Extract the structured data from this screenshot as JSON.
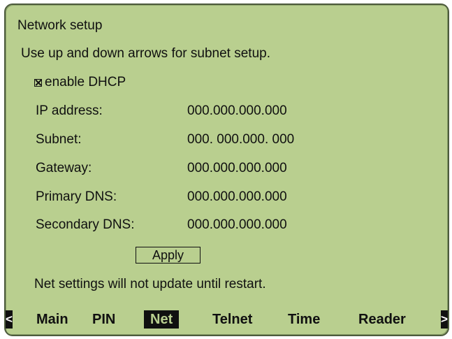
{
  "screen": {
    "title": "Network setup",
    "instructions": "Use up and down arrows for subnet setup."
  },
  "dhcp": {
    "checked": true,
    "label": "enable DHCP"
  },
  "fields": {
    "ip": {
      "label": "IP address:",
      "value": "000.000.000.000"
    },
    "subnet": {
      "label": "Subnet:",
      "value": "000. 000.000. 000"
    },
    "gateway": {
      "label": "Gateway:",
      "value": "000.000.000.000"
    },
    "primary_dns": {
      "label": "Primary DNS:",
      "value": "000.000.000.000"
    },
    "secondary_dns": {
      "label": "Secondary DNS:",
      "value": "000.000.000.000"
    }
  },
  "apply_label": "Apply",
  "notice": "Net settings will not update until restart.",
  "tabs": {
    "prev_arrow": "<",
    "next_arrow": ">",
    "items": [
      "Main",
      "PIN",
      "Net",
      "Telnet",
      "Time",
      "Reader"
    ],
    "active": "Net"
  },
  "colors": {
    "screen_bg": "#b9cf8f",
    "text": "#101010",
    "border": "#4d5b3d"
  }
}
